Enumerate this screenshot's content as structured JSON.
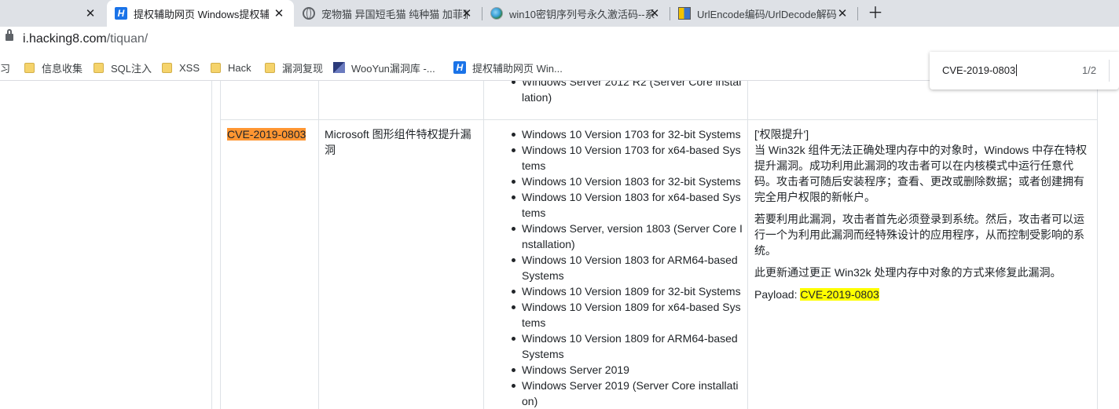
{
  "tabs": [
    {
      "title": "",
      "active": false
    },
    {
      "title": "提权辅助网页 Windows提权辅助",
      "active": true,
      "favicon": "h-logo-icon"
    },
    {
      "title": "宠物猫 异国短毛猫 纯种猫 加菲猫",
      "active": false,
      "favicon": "globe-icon"
    },
    {
      "title": "win10密钥序列号永久激活码--系",
      "active": false,
      "favicon": "win10-site-icon"
    },
    {
      "title": "UrlEncode编码/UrlDecode解码",
      "active": false,
      "favicon": "urlencode-site-icon"
    }
  ],
  "address_bar": {
    "host": "i.hacking8.com",
    "path": "/tiquan/"
  },
  "bookmarks": [
    {
      "label": "习",
      "icon": "none"
    },
    {
      "label": "信息收集",
      "icon": "folder-icon"
    },
    {
      "label": "SQL注入",
      "icon": "folder-icon"
    },
    {
      "label": "XSS",
      "icon": "folder-icon"
    },
    {
      "label": "Hack",
      "icon": "folder-icon"
    },
    {
      "label": "漏洞复现",
      "icon": "folder-icon"
    },
    {
      "label": "WooYun漏洞库 -...",
      "icon": "wooyun-icon"
    },
    {
      "label": "提权辅助网页 Win...",
      "icon": "h-logo-icon"
    }
  ],
  "find_bar": {
    "query": "CVE-2019-0803",
    "count": "1/2"
  },
  "table": {
    "prev_row": {
      "systems": [
        "Windows Server 2012 R2 (Server Core installation)"
      ]
    },
    "row": {
      "cve": "CVE-2019-0803",
      "title": "Microsoft 图形组件特权提升漏洞",
      "systems": [
        "Windows 10 Version 1703 for 32-bit Systems",
        "Windows 10 Version 1703 for x64-based Systems",
        "Windows 10 Version 1803 for 32-bit Systems",
        "Windows 10 Version 1803 for x64-based Systems",
        "Windows Server, version 1803 (Server Core Installation)",
        "Windows 10 Version 1803 for ARM64-based Systems",
        "Windows 10 Version 1809 for 32-bit Systems",
        "Windows 10 Version 1809 for x64-based Systems",
        "Windows 10 Version 1809 for ARM64-based Systems",
        "Windows Server 2019",
        "Windows Server 2019 (Server Core installation)"
      ],
      "desc_tag": "['权限提升']",
      "desc_p1": "当 Win32k 组件无法正确处理内存中的对象时，Windows 中存在特权提升漏洞。成功利用此漏洞的攻击者可以在内核模式中运行任意代码。攻击者可随后安装程序；查看、更改或删除数据；或者创建拥有完全用户权限的新帐户。",
      "desc_p2": "若要利用此漏洞，攻击者首先必须登录到系统。然后，攻击者可以运行一个为利用此漏洞而经特殊设计的应用程序，从而控制受影响的系统。",
      "desc_p3": "此更新通过更正 Win32k 处理内存中对象的方式来修复此漏洞。",
      "payload_label": "Payload: ",
      "payload_value": "CVE-2019-0803"
    }
  }
}
